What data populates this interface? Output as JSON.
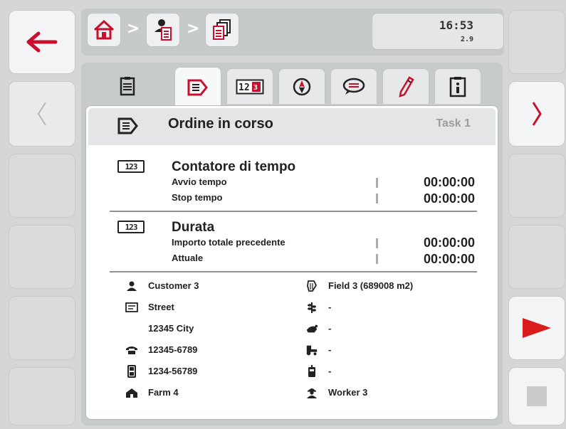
{
  "header": {
    "time": "16:53",
    "version": "2.9"
  },
  "tabs": [
    {
      "name": "task-list-icon"
    },
    {
      "name": "order-icon",
      "active": true
    },
    {
      "name": "counter-icon",
      "text": "12"
    },
    {
      "name": "compass-icon"
    },
    {
      "name": "note-bubble-icon"
    },
    {
      "name": "pencil-icon"
    },
    {
      "name": "info-icon"
    }
  ],
  "order": {
    "title": "Ordine in corso",
    "task": "Task 1"
  },
  "time_counter": {
    "title": "Contatore di tempo",
    "start_label": "Avvio tempo",
    "start_value": "00:00:00",
    "stop_label": "Stop tempo",
    "stop_value": "00:00:00"
  },
  "duration": {
    "title": "Durata",
    "prev_label": "Importo totale precedente",
    "prev_value": "00:00:00",
    "current_label": "Attuale",
    "current_value": "00:00:00"
  },
  "details": {
    "customer": "Customer 3",
    "street": "Street",
    "city": "12345 City",
    "phone": "12345-6789",
    "mobile": "1234-56789",
    "farm": "Farm 4",
    "field": "Field 3 (689008 m2)",
    "crop": "-",
    "product": "-",
    "machine": "-",
    "device": "-",
    "worker": "Worker 3"
  },
  "colors": {
    "accent_red": "#c8102e",
    "play_red": "#d91c1c"
  }
}
